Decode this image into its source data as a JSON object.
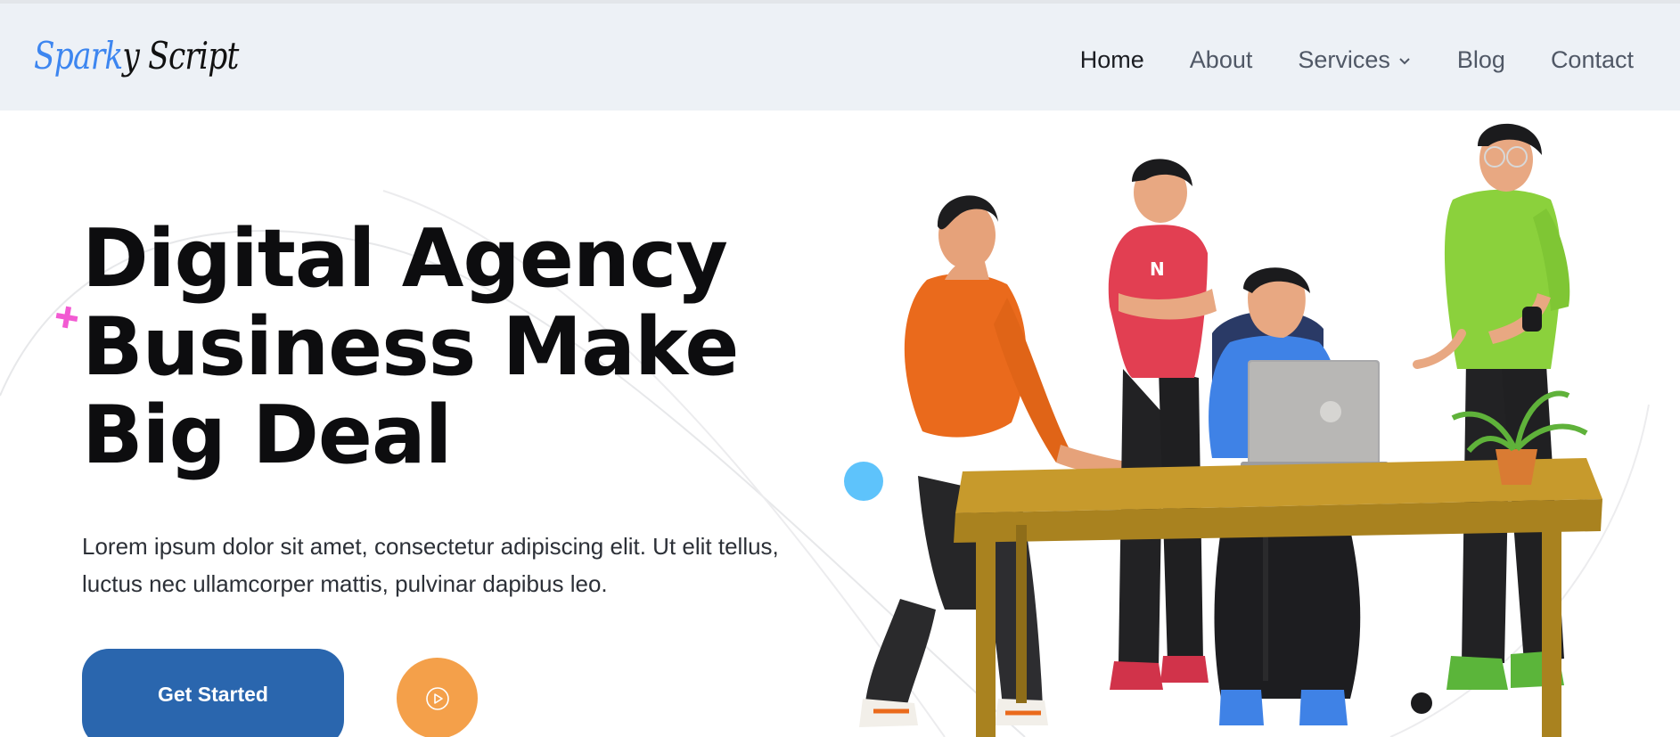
{
  "brand": {
    "part1": "Spark",
    "part2": "y Script"
  },
  "nav": {
    "items": [
      {
        "label": "Home",
        "active": true
      },
      {
        "label": "About"
      },
      {
        "label": "Services",
        "dropdown": true
      },
      {
        "label": "Blog"
      },
      {
        "label": "Contact"
      }
    ]
  },
  "hero": {
    "title_lines": [
      "Digital Agency",
      "Business Make",
      "Big Deal"
    ],
    "description": "Lorem ipsum dolor sit amet, consectetur adipiscing elit. Ut elit tellus, luctus nec ullamcorper mattis, pulvinar dapibus leo.",
    "cta_label": "Get Started",
    "play_icon": "play-circle-icon",
    "laptop_letter": "N"
  },
  "colors": {
    "header_bg": "#edf1f6",
    "logo_blue": "#3d86f0",
    "cta_blue": "#2a66ae",
    "play_orange": "#f4a04a",
    "accent_dot": "#5ec3fb",
    "plus_pink": "#f25ad2"
  }
}
